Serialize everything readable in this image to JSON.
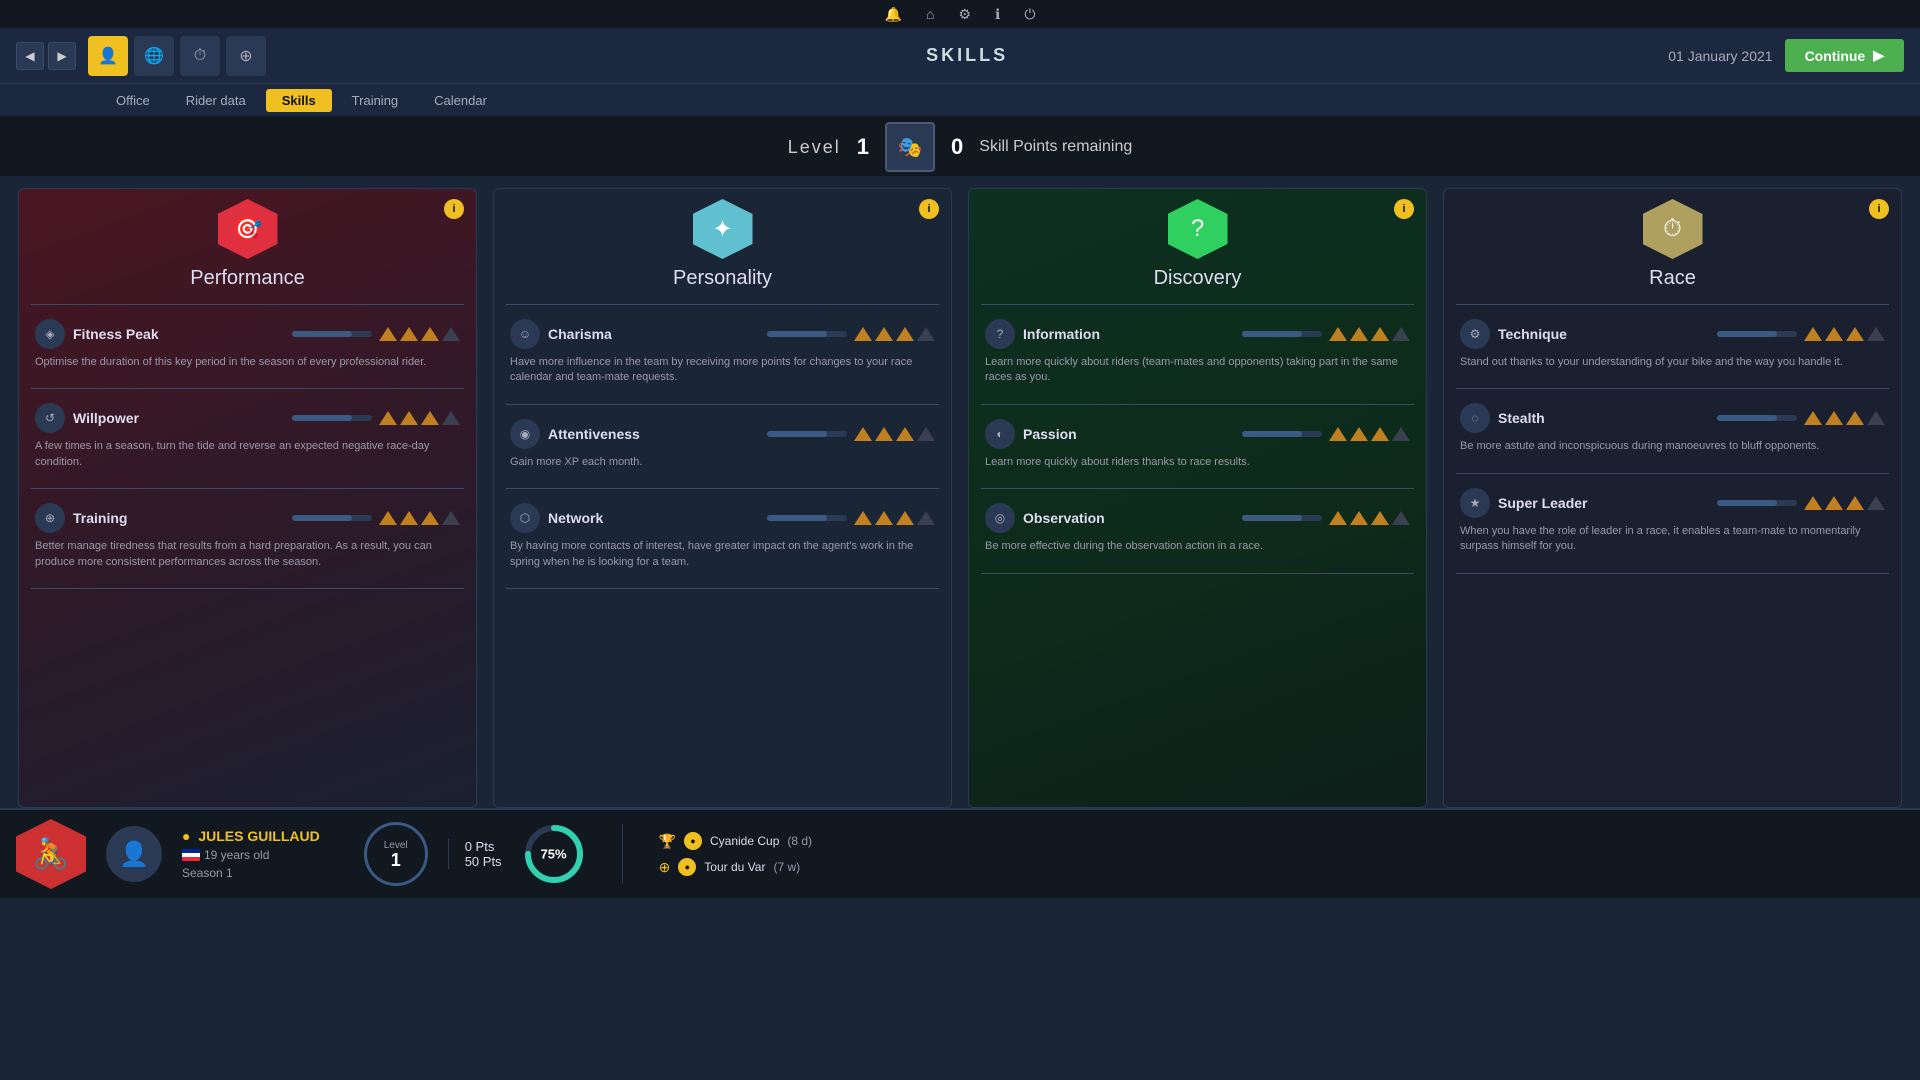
{
  "topbar": {
    "icons": [
      "🔔",
      "🏠",
      "⚙",
      "ℹ",
      "⏻"
    ]
  },
  "navbar": {
    "title": "SKILLS",
    "date": "01 January 2021",
    "continue_label": "Continue"
  },
  "subnav": {
    "tabs": [
      "Office",
      "Rider data",
      "Skills",
      "Training",
      "Calendar"
    ],
    "active": "Skills"
  },
  "level_bar": {
    "level_label": "Level",
    "level_num": "1",
    "skill_points": "0",
    "skill_points_label": "Skill Points remaining"
  },
  "cards": [
    {
      "id": "performance",
      "title": "Performance",
      "hex_color": "red",
      "hex_icon": "🎯",
      "skills": [
        {
          "name": "Fitness Peak",
          "icon": "◈",
          "bars": 3,
          "max_bars": 4,
          "desc": "Optimise the duration of this key period in the season of every professional rider."
        },
        {
          "name": "Willpower",
          "icon": "↺",
          "bars": 3,
          "max_bars": 4,
          "desc": "A few times in a season, turn the tide and reverse an expected negative race-day condition."
        },
        {
          "name": "Training",
          "icon": "⊕",
          "bars": 3,
          "max_bars": 4,
          "desc": "Better manage tiredness that results from a hard preparation. As a result, you can produce more consistent performances across the season."
        }
      ]
    },
    {
      "id": "personality",
      "title": "Personality",
      "hex_color": "cyan",
      "hex_icon": "✦",
      "skills": [
        {
          "name": "Charisma",
          "icon": "☺",
          "bars": 3,
          "max_bars": 4,
          "desc": "Have more influence in the team by receiving more points for changes to your race calendar and team-mate requests."
        },
        {
          "name": "Attentiveness",
          "icon": "◉",
          "bars": 3,
          "max_bars": 4,
          "desc": "Gain more XP each month."
        },
        {
          "name": "Network",
          "icon": "⬡",
          "bars": 3,
          "max_bars": 4,
          "desc": "By having more contacts of interest, have greater impact on the agent's work in the spring when he is looking for a team."
        }
      ]
    },
    {
      "id": "discovery",
      "title": "Discovery",
      "hex_color": "green",
      "hex_icon": "?",
      "skills": [
        {
          "name": "Information",
          "icon": "?",
          "bars": 3,
          "max_bars": 4,
          "desc": "Learn more quickly about riders (team-mates and opponents) taking part in the same races as you."
        },
        {
          "name": "Passion",
          "icon": "◐",
          "bars": 3,
          "max_bars": 4,
          "desc": "Learn more quickly about riders thanks to race results."
        },
        {
          "name": "Observation",
          "icon": "◎",
          "bars": 3,
          "max_bars": 4,
          "desc": "Be more effective during the observation action in a race."
        }
      ]
    },
    {
      "id": "race",
      "title": "Race",
      "hex_color": "tan",
      "hex_icon": "⏱",
      "skills": [
        {
          "name": "Technique",
          "icon": "⚙",
          "bars": 3,
          "max_bars": 4,
          "desc": "Stand out thanks to your understanding of your bike and the way you handle it."
        },
        {
          "name": "Stealth",
          "icon": "◌",
          "bars": 3,
          "max_bars": 4,
          "desc": "Be more astute and inconspicuous during manoeuvres to bluff opponents."
        },
        {
          "name": "Super Leader",
          "icon": "★",
          "bars": 3,
          "max_bars": 4,
          "desc": "When you have the role of leader in a race, it enables a team-mate to momentarily surpass himself for you."
        }
      ]
    }
  ],
  "bottom": {
    "rider_name": "JULES GUILLAUD",
    "rider_name_dot": "●",
    "rider_age": "19 years old",
    "rider_season": "Season 1",
    "level_label": "Level",
    "level_num": "1",
    "pts_current": "0 Pts",
    "pts_total": "50 Pts",
    "progress_pct": "75%",
    "races": [
      {
        "icon": "🏆",
        "name": "Cyanide Cup",
        "detail": "(8 d)"
      },
      {
        "icon": "⊕",
        "name": "Tour du Var",
        "detail": "(7 w)"
      }
    ]
  }
}
